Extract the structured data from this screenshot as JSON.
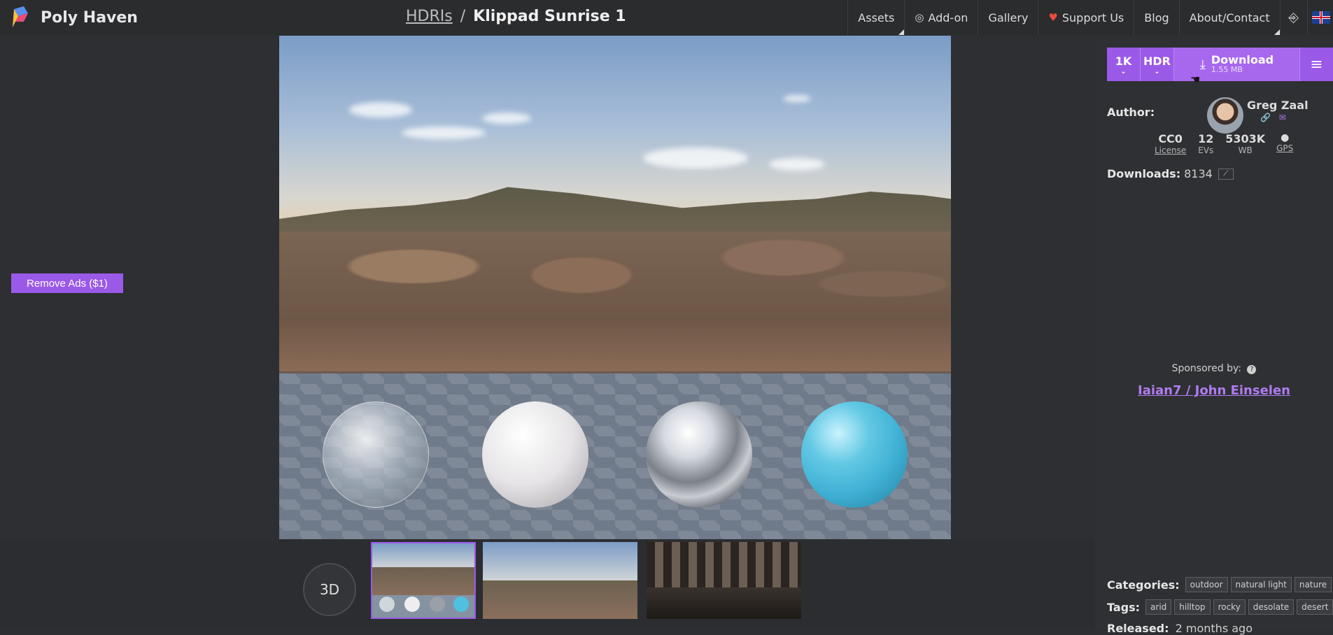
{
  "header": {
    "brand": "Poly Haven",
    "breadcrumb_section": "HDRIs",
    "breadcrumb_separator": "/",
    "asset_title": "Klippad Sunrise 1",
    "nav": [
      {
        "label": "Assets"
      },
      {
        "label": "Add-on",
        "icon": "blender-icon"
      },
      {
        "label": "Gallery"
      },
      {
        "label": "Support Us",
        "icon": "heart-icon"
      },
      {
        "label": "Blog"
      },
      {
        "label": "About/Contact"
      }
    ],
    "login_icon": "login-icon",
    "language_flag": "uk-flag-icon"
  },
  "ads": {
    "remove_ads_label": "Remove Ads ($1)"
  },
  "viewer": {
    "toggle_3d_label": "3D"
  },
  "download": {
    "resolution": "1K",
    "format": "HDR",
    "label": "Download",
    "size": "1.55 MB"
  },
  "author": {
    "label": "Author:",
    "name": "Greg Zaal"
  },
  "stats": [
    {
      "value": "CC0",
      "key": "License"
    },
    {
      "value": "12",
      "key": "EVs"
    },
    {
      "value": "5303K",
      "key": "WB"
    },
    {
      "value": "",
      "key": "GPS"
    }
  ],
  "downloads": {
    "label": "Downloads:",
    "count": "8134"
  },
  "sponsor": {
    "label": "Sponsored by:",
    "name": "Iaian7 / John Einselen"
  },
  "categories": {
    "label": "Categories:",
    "items": [
      "outdoor",
      "natural light",
      "nature"
    ],
    "more": "..."
  },
  "tags": {
    "label": "Tags:",
    "items": [
      "arid",
      "hilltop",
      "rocky",
      "desolate",
      "desert"
    ],
    "more": "..."
  },
  "released": {
    "label": "Released:",
    "value": "2 months ago"
  },
  "colors": {
    "accent": "#9b59e8",
    "background": "#2d2f32"
  }
}
